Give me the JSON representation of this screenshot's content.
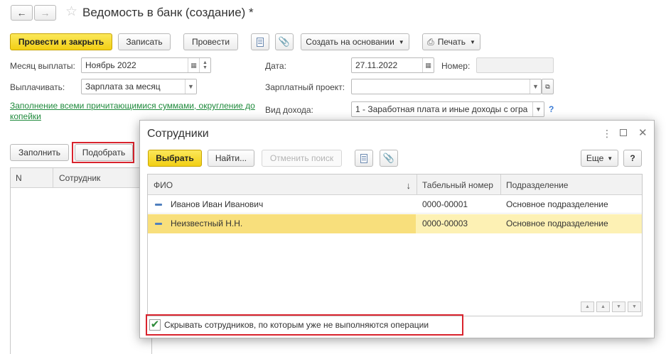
{
  "window": {
    "title": "Ведомость в банк (создание) *"
  },
  "toolbar": {
    "post_close": "Провести и закрыть",
    "save": "Записать",
    "post": "Провести",
    "create_based": "Создать на основании",
    "print": "Печать"
  },
  "form": {
    "month_label": "Месяц выплаты:",
    "month_value": "Ноябрь 2022",
    "pay_label": "Выплачивать:",
    "pay_value": "Зарплата за месяц",
    "fill_link": "Заполнение всеми причитающимися суммами, округление до копейки",
    "date_label": "Дата:",
    "date_value": "27.11.2022",
    "number_label": "Номер:",
    "number_value": "",
    "salary_project_label": "Зарплатный проект:",
    "salary_project_value": "",
    "income_type_label": "Вид дохода:",
    "income_type_value": "1 - Заработная плата и иные доходы с огра",
    "help": "?"
  },
  "table_bar": {
    "fill": "Заполнить",
    "pick": "Подобрать",
    "col_n": "N",
    "col_employee": "Сотрудник"
  },
  "dialog": {
    "title": "Сотрудники",
    "select": "Выбрать",
    "find": "Найти...",
    "cancel_search": "Отменить поиск",
    "more": "Еще",
    "help": "?",
    "columns": [
      "ФИО",
      "Табельный номер",
      "Подразделение"
    ],
    "sort_arrow": "↓",
    "rows": [
      {
        "name": "Иванов Иван Иванович",
        "tab": "0000-00001",
        "dept": "Основное подразделение"
      },
      {
        "name": "Неизвестный Н.Н.",
        "tab": "0000-00003",
        "dept": "Основное подразделение"
      }
    ],
    "hide_checkbox_label": "Скрывать сотрудников, по которым уже не выполняются операции",
    "hide_checked": true
  },
  "colors": {
    "accent_yellow": "#f5d51d",
    "highlight_red": "#d9232d",
    "link_green": "#1f8a3c",
    "selected_row": "#fdf1b4"
  }
}
